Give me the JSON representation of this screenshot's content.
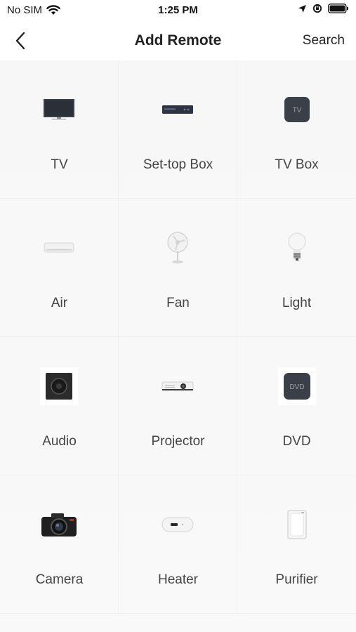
{
  "status": {
    "carrier": "No SIM",
    "time": "1:25 PM"
  },
  "nav": {
    "title": "Add Remote",
    "search_label": "Search"
  },
  "devices": [
    {
      "label": "TV",
      "icon": "tv-icon",
      "badge": ""
    },
    {
      "label": "Set-top Box",
      "icon": "set-top-box-icon",
      "badge": ""
    },
    {
      "label": "TV Box",
      "icon": "tv-box-icon",
      "badge": "TV"
    },
    {
      "label": "Air",
      "icon": "air-conditioner-icon",
      "badge": ""
    },
    {
      "label": "Fan",
      "icon": "fan-icon",
      "badge": ""
    },
    {
      "label": "Light",
      "icon": "light-bulb-icon",
      "badge": ""
    },
    {
      "label": "Audio",
      "icon": "speaker-icon",
      "badge": ""
    },
    {
      "label": "Projector",
      "icon": "projector-icon",
      "badge": ""
    },
    {
      "label": "DVD",
      "icon": "dvd-player-icon",
      "badge": "DVD"
    },
    {
      "label": "Camera",
      "icon": "camera-icon",
      "badge": ""
    },
    {
      "label": "Heater",
      "icon": "heater-icon",
      "badge": ""
    },
    {
      "label": "Purifier",
      "icon": "purifier-icon",
      "badge": ""
    }
  ]
}
